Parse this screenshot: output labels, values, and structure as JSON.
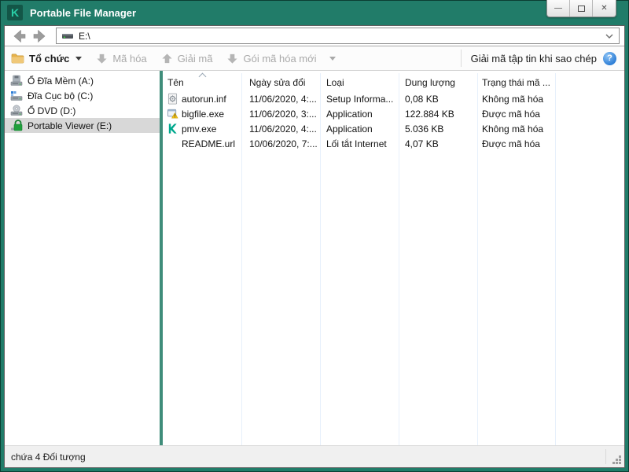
{
  "window": {
    "title": "Portable File Manager",
    "logo_letter": "K"
  },
  "window_controls": {
    "minimize": "—",
    "close": "✕"
  },
  "navigation": {
    "address_value": "E:\\"
  },
  "toolbar": {
    "organize_label": "Tổ chức",
    "encrypt_label": "Mã hóa",
    "decrypt_label": "Giải mã",
    "new_package_label": "Gói mã hóa mới",
    "decrypt_on_copy_label": "Giải mã tập tin khi sao chép",
    "help_glyph": "?"
  },
  "sidebar": {
    "items": [
      {
        "label": "Ổ Đĩa Mềm (A:)",
        "icon": "floppy-drive-icon",
        "selected": false
      },
      {
        "label": "Đĩa Cục bộ (C:)",
        "icon": "local-disk-icon",
        "selected": false
      },
      {
        "label": "Ổ DVD (D:)",
        "icon": "dvd-drive-icon",
        "selected": false
      },
      {
        "label": "Portable Viewer (E:)",
        "icon": "lock-icon",
        "selected": true
      }
    ]
  },
  "table": {
    "columns": [
      {
        "label": "Tên"
      },
      {
        "label": "Ngày sửa đổi"
      },
      {
        "label": "Loại"
      },
      {
        "label": "Dung lượng"
      },
      {
        "label": "Trạng thái mã ..."
      }
    ],
    "sort_column": "Tên",
    "rows": [
      {
        "name": "autorun.inf",
        "icon": "setup-file-icon",
        "modified": "11/06/2020, 4:...",
        "type": "Setup Informa...",
        "size": "0,08 KB",
        "status": "Không mã hóa"
      },
      {
        "name": "bigfile.exe",
        "icon": "exe-file-icon",
        "modified": "11/06/2020, 3:...",
        "type": "Application",
        "size": "122.884 KB",
        "status": "Được mã hóa"
      },
      {
        "name": "pmv.exe",
        "icon": "kaspersky-app-icon",
        "modified": "11/06/2020, 4:...",
        "type": "Application",
        "size": "5.036 KB",
        "status": "Không mã hóa"
      },
      {
        "name": "README.url",
        "icon": "none",
        "modified": "10/06/2020, 7:...",
        "type": "Lối tắt Internet",
        "size": "4,07 KB",
        "status": "Được mã hóa"
      }
    ]
  },
  "statusbar": {
    "text": "chứa 4 Đối tượng"
  },
  "icons": {
    "back-icon": "◀",
    "forward-icon": "▶",
    "chevron-down-icon": "⌄",
    "folder-icon": "📁",
    "arrow-down-icon": "⇩",
    "arrow-up-icon": "⇧",
    "help-icon": "?",
    "sort-ascending-icon": "^"
  },
  "colors": {
    "titlebar_teal": "#217c69",
    "logo_bg": "#135647",
    "logo_letter": "#29cfa6",
    "pane_divider": "#3f8d7a",
    "selection_bg": "#d8d8d8",
    "disabled_text": "#a9a9a9",
    "column_line": "#e7f0fb",
    "folder_gold": "#e6b14a",
    "help_blue": "#2f7fd6",
    "lock_green": "#1fa03c",
    "kaspersky_green": "#00a88e"
  }
}
